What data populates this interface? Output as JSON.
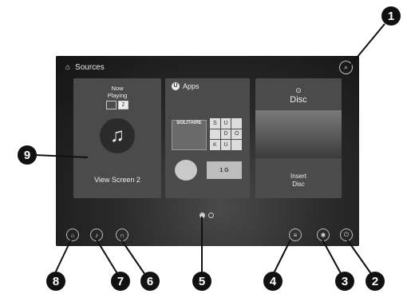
{
  "header": {
    "title": "Sources"
  },
  "tiles": {
    "now_playing": {
      "line1": "Now",
      "line2": "Playing",
      "screen_a": "",
      "screen_b": "2",
      "label": "View Screen 2"
    },
    "apps": {
      "label": "Apps",
      "solitaire": "SOLITAIRE",
      "sudoku": [
        "S",
        "U",
        "",
        "",
        "D",
        "O",
        "K",
        "U",
        ""
      ],
      "big_game": "1 G"
    },
    "disc": {
      "label": "Disc",
      "action_line1": "Insert",
      "action_line2": "Disc"
    }
  },
  "callouts": {
    "c1": "1",
    "c2": "2",
    "c3": "3",
    "c4": "4",
    "c5": "5",
    "c6": "6",
    "c7": "7",
    "c8": "8",
    "c9": "9"
  }
}
